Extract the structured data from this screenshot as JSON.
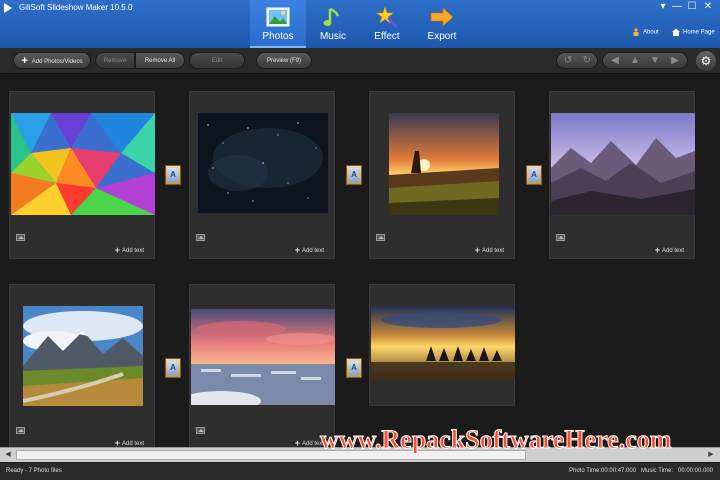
{
  "window": {
    "title": "GiliSoft Slideshow Maker 10.5.0",
    "controls": {
      "menu": "▾",
      "minimize": "—",
      "maximize": "☐",
      "close": "✕"
    }
  },
  "tabs": [
    {
      "label": "Photos",
      "icon": "photo-icon",
      "active": true
    },
    {
      "label": "Music",
      "icon": "music-note-icon",
      "active": false
    },
    {
      "label": "Effect",
      "icon": "magic-wand-icon",
      "active": false
    },
    {
      "label": "Export",
      "icon": "export-arrow-icon",
      "active": false
    }
  ],
  "links": {
    "about": "About",
    "home_page": "Home Page"
  },
  "toolbar": {
    "add": "Add Photos/Videos",
    "remove": "Remove",
    "remove_all": "Remove All",
    "edit": "Edit",
    "preview": "Preview (F9)",
    "icons": [
      "rotate-left-icon",
      "rotate-right-icon",
      "move-left-icon",
      "move-up-icon",
      "move-down-icon",
      "move-right-icon",
      "settings-gear-icon"
    ]
  },
  "photos": [
    {
      "name": "colorful-polygon-abstract",
      "add_text": "Add text"
    },
    {
      "name": "starry-night-sky",
      "add_text": "Add text"
    },
    {
      "name": "desert-sunset-rocks",
      "add_text": "Add text"
    },
    {
      "name": "purple-mountain-range",
      "add_text": "Add text"
    },
    {
      "name": "alpine-meadow-road",
      "add_text": "Add text"
    },
    {
      "name": "city-sunset-aerial",
      "add_text": "Add text"
    },
    {
      "name": "lake-boats-sunset",
      "add_text": "Add text"
    }
  ],
  "transition_glyph": "A",
  "status": {
    "left": "Ready - 7 Photo files",
    "photo_time": "Photo Time:00:00:47.000",
    "music_time": "Music Time:   00:00:00.000"
  },
  "watermark": "www.RepackSoftwareHere.com",
  "colors": {
    "title_bar": "#2466c0",
    "active_tab": "#3b82e0",
    "background": "#1d1d1d",
    "watermark": "#ff4a2e"
  }
}
